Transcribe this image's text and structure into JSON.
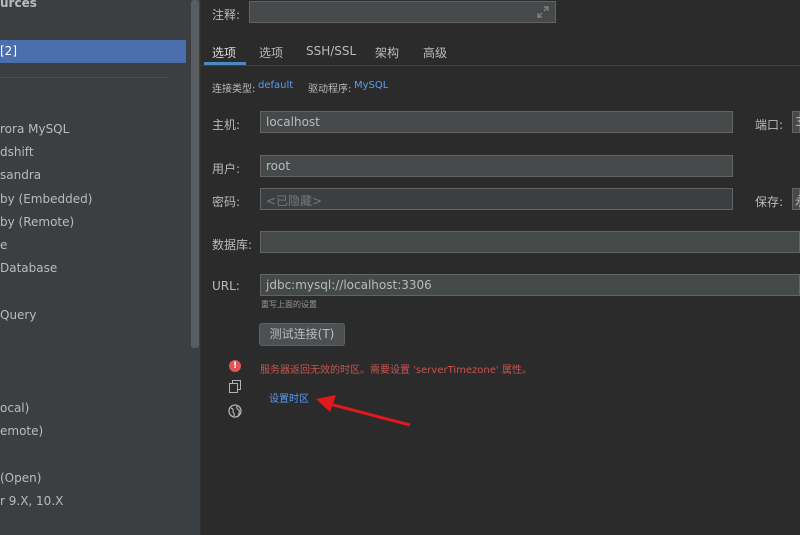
{
  "sidebar": {
    "title": "urces",
    "selected": "[2]",
    "items": [
      "rora MySQL",
      "dshift",
      "sandra",
      "by (Embedded)",
      "by (Remote)",
      "e",
      "Database",
      "Query",
      "ocal)",
      "emote)",
      "(Open)",
      "r 9.X, 10.X"
    ]
  },
  "comment": {
    "label": "注释:",
    "value": ""
  },
  "tabs": [
    "选项",
    "选项",
    "SSH/SSL",
    "架构",
    "高级"
  ],
  "info": {
    "conn_type_label": "连接类型:",
    "conn_type_value": "default",
    "driver_label": "驱动程序:",
    "driver_value": "MySQL"
  },
  "host": {
    "label": "主机:",
    "value": "localhost"
  },
  "port": {
    "label": "端口:",
    "value": "3"
  },
  "user": {
    "label": "用户:",
    "value": "root"
  },
  "password": {
    "label": "密码:",
    "placeholder": "<已隐藏>"
  },
  "save": {
    "label": "保存:",
    "value": "永"
  },
  "database": {
    "label": "数据库:",
    "value": ""
  },
  "url": {
    "label": "URL:",
    "value": "jdbc:mysql://localhost:3306",
    "hint": "重写上面的设置"
  },
  "test_button": "测试连接(T)",
  "error": {
    "message": "服务器返回无效的时区。需要设置 'serverTimezone' 属性。",
    "link": "设置时区"
  },
  "colors": {
    "accent": "#4a88c7",
    "link": "#589df6",
    "error": "#c75450",
    "arrow": "#e0191c"
  }
}
